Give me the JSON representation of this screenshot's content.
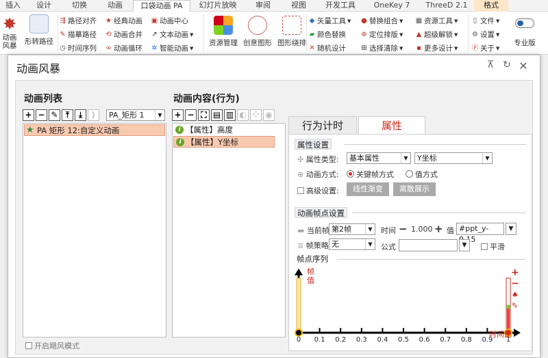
{
  "ribbon": {
    "tabs": [
      "插入",
      "设计",
      "切换",
      "动画",
      "口袋动画 PA",
      "幻灯片放映",
      "审阅",
      "视图",
      "开发工具",
      "OneKey 7",
      "ThreeD 2.1",
      "格式"
    ],
    "active_tab": "口袋动画 PA",
    "left_big_label": "动画\n风暴",
    "shape_path_label": "形转路径",
    "group1": [
      "路径对齐",
      "描摹路径",
      "时间序列"
    ],
    "group2": [
      "经典动画",
      "动画合并",
      "动画循环"
    ],
    "group3": [
      "动画中心",
      "文本动画",
      "智能动画"
    ],
    "resource_label": "资源管理",
    "creative_label": "创意图形",
    "pattern_label": "图形绕排",
    "group4": [
      "矢量工具",
      "颜色替换",
      "随机设计"
    ],
    "group5": [
      "替换组合",
      "定位排版",
      "选择清除"
    ],
    "group6": [
      "资源工具",
      "超级解锁",
      "更多设计"
    ],
    "group7": [
      "文件",
      "设置",
      "关于"
    ],
    "pro_label": "专业版"
  },
  "dialog": {
    "title": "动画风暴",
    "pin_icon": "pin-icon",
    "refresh_icon": "refresh-icon",
    "close_icon": "close-icon"
  },
  "anim_list": {
    "header": "动画列表",
    "toolbar": [
      "add-icon",
      "remove-icon",
      "brush-icon",
      "move-up-icon",
      "move-down-icon",
      "bracket-icon"
    ],
    "selector_value": "PA_矩形 1",
    "items": [
      {
        "text": "PA  矩形 12:自定义动画",
        "selected": true
      }
    ]
  },
  "anim_content": {
    "header": "动画内容(行为)",
    "items": [
      {
        "text": "【属性】高度",
        "selected": false
      },
      {
        "text": "【属性】Y坐标",
        "selected": true
      }
    ]
  },
  "tabs": {
    "timing": "行为计时",
    "property": "属性",
    "active": "属性"
  },
  "props": {
    "group_title": "属性设置",
    "type_label": "属性类型:",
    "type_value": "基本属性",
    "coord_value": "Y坐标",
    "mode_label": "动画方式:",
    "mode_keyframe": "关键帧方式",
    "mode_value": "值方式",
    "mode_selected": "关键帧方式",
    "advanced_label": "高级设置:",
    "linear_btn": "线性渐变",
    "discrete_btn": "离散展示"
  },
  "keyframe": {
    "group_title": "动画帧点设置",
    "current_label": "当前帧",
    "current_value": "第2帧",
    "time_label": "时间",
    "time_value": "1.000",
    "value_label": "值",
    "value_value": "#ppt_y-0.15",
    "strategy_label": "帧策略",
    "strategy_value": "无",
    "formula_label": "公式",
    "formula_value": "",
    "smooth_label": "平滑"
  },
  "sequence": {
    "group_title": "帧点序列",
    "y_label": "帧\n值",
    "x_label": "时间比",
    "ticks": [
      "0",
      "0.1",
      "0.2",
      "0.3",
      "0.4",
      "0.5",
      "0.6",
      "0.7",
      "0.8",
      "0.9",
      "1"
    ],
    "frame_times": [
      0,
      1
    ]
  },
  "footer": {
    "watch_mode": "开启飓风模式"
  }
}
